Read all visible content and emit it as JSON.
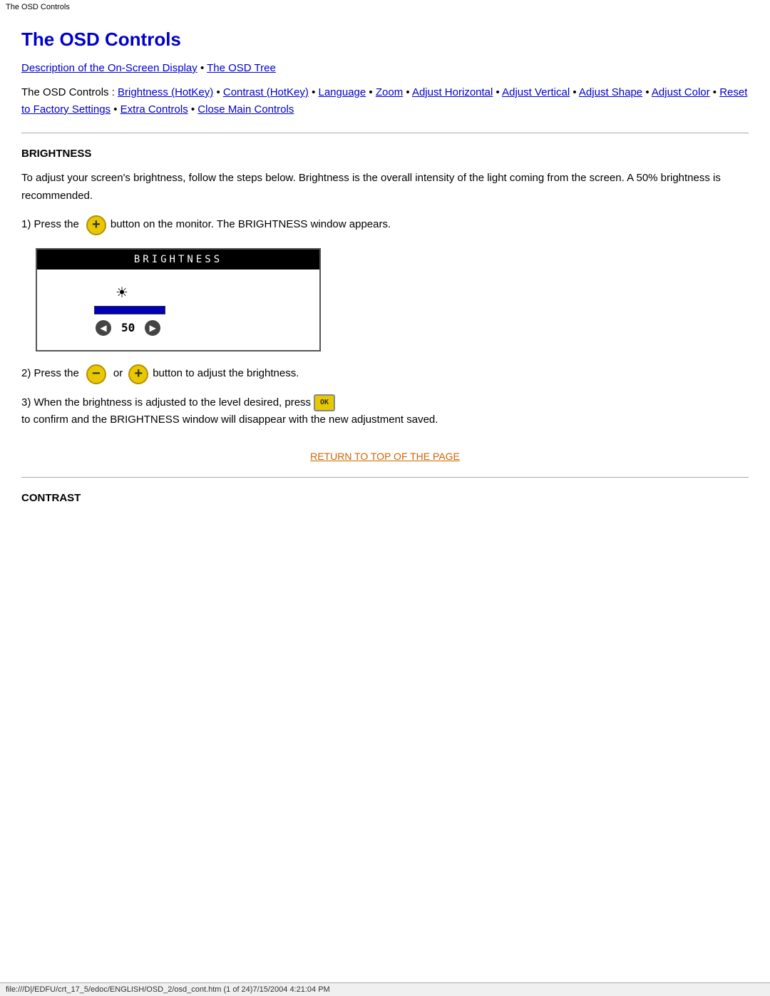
{
  "title_bar": {
    "text": "The OSD Controls"
  },
  "page": {
    "title": "The OSD Controls",
    "nav": {
      "link1": "Description of the On-Screen Display",
      "separator1": " • ",
      "link2": "The OSD Tree"
    },
    "intro_prefix": "The OSD Controls : ",
    "links": [
      "Brightness (HotKey)",
      "Contrast (HotKey)",
      "Language",
      "Zoom",
      "Adjust Horizontal",
      "Adjust Vertical",
      "Adjust Shape",
      "Adjust Color",
      "Reset to Factory Settings",
      "Extra Controls",
      "Close Main Controls"
    ],
    "sections": [
      {
        "id": "brightness",
        "heading": "BRIGHTNESS",
        "body": "To adjust your screen's brightness, follow the steps below. Brightness is the overall intensity of the light coming from the screen. A 50% brightness is recommended.",
        "step1_prefix": "1) Press the",
        "step1_suffix": "button on the monitor. The BRIGHTNESS window appears.",
        "osd_title": "BRIGHTNESS",
        "osd_value": "50",
        "step2_prefix": "2) Press the",
        "step2_middle": "or",
        "step2_suffix": "button to adjust the brightness.",
        "step3_prefix": "3) When the brightness is adjusted to the level desired, press",
        "step3_suffix": "to confirm and the BRIGHTNESS window will disappear with the new adjustment saved."
      }
    ],
    "return_link": "RETURN TO TOP OF THE PAGE",
    "contrast_heading": "CONTRAST"
  },
  "status_bar": {
    "text": "file:///D|/EDFU/crt_17_5/edoc/ENGLISH/OSD_2/osd_cont.htm (1 of 24)7/15/2004 4:21:04 PM"
  }
}
